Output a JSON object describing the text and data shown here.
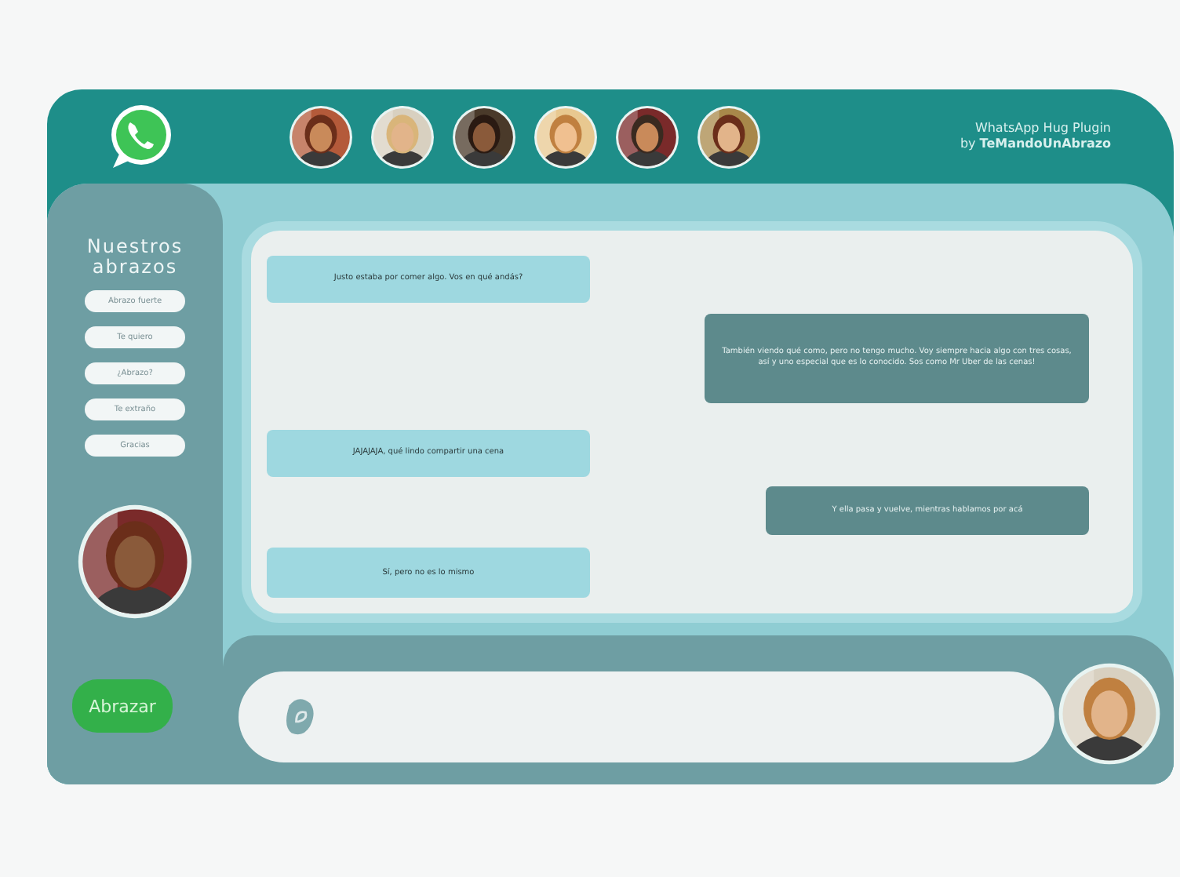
{
  "header": {
    "title": "WhatsApp Hug Plugin",
    "byline": "by **TeMandoUnAbrazo**"
  },
  "sidebar": {
    "title": "Nuestros abrazos",
    "items": [
      {
        "label": "Abrazo fuerte"
      },
      {
        "label": "Te quiero"
      },
      {
        "label": "¿Abrazo?"
      },
      {
        "label": "Te extraño"
      },
      {
        "label": "Gracias"
      }
    ],
    "hug_button": "Abrazar"
  },
  "messages": [
    {
      "kind": "incoming",
      "text": "Justo estaba por comer algo. Vos en qué andás?"
    },
    {
      "kind": "outgoing",
      "text": "También viendo qué como, pero no tengo mucho. Voy siempre hacia algo con tres cosas, así y uno especial que es lo conocido. Sos como Mr Uber de las cenas!"
    },
    {
      "kind": "incoming",
      "text": "JAJAJAJA, qué lindo compartir una cena"
    },
    {
      "kind": "outgoing",
      "text": "Y ella pasa y vuelve, mientras hablamos por acá"
    },
    {
      "kind": "incoming",
      "text": "Sí, pero no es lo mismo"
    }
  ]
}
